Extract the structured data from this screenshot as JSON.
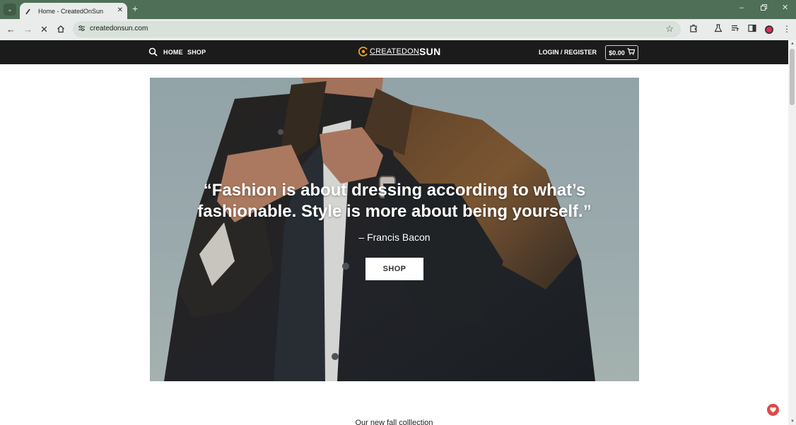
{
  "browser": {
    "tab_title": "Home - CreatedOnSun",
    "url": "createdonsun.com",
    "icons": [
      "tab-list-icon",
      "favicon-icon",
      "close-icon",
      "new-tab-icon",
      "minimize-icon",
      "restore-icon",
      "window-close-icon",
      "back-icon",
      "forward-icon",
      "stop-icon",
      "home-icon",
      "site-info-icon",
      "star-icon",
      "extensions-icon",
      "labs-icon",
      "media-icon",
      "side-panel-icon",
      "profile-icon",
      "menu-icon"
    ]
  },
  "header": {
    "nav": {
      "home": "HOME",
      "shop": "SHOP"
    },
    "logo": {
      "part1": "CREATEDON",
      "part2": "SUN"
    },
    "account": "LOGIN / REGISTER",
    "cart_total": "$0.00"
  },
  "hero": {
    "quote_line1": "“Fashion is about dressing according to what’s",
    "quote_line2": "fashionable. Style is more about being yourself.”",
    "author": "– Francis Bacon",
    "button": "SHOP"
  },
  "section": {
    "heading": "Our new fall colllection"
  },
  "colors": {
    "browser_frame": "#4f7056",
    "header_bg": "#1b1b1b",
    "accent": "#e04848"
  }
}
